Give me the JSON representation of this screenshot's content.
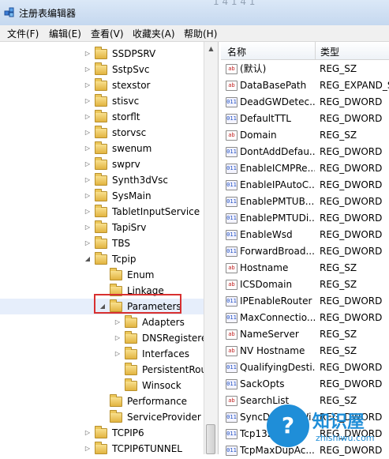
{
  "window": {
    "title": "注册表编辑器",
    "ghost_title": "1 4 1 4 1"
  },
  "menu": [
    "文件(F)",
    "编辑(E)",
    "查看(V)",
    "收藏夹(A)",
    "帮助(H)"
  ],
  "tree": [
    {
      "label": "SSDPSRV",
      "arrow": "▷"
    },
    {
      "label": "SstpSvc",
      "arrow": "▷"
    },
    {
      "label": "stexstor",
      "arrow": "▷"
    },
    {
      "label": "stisvc",
      "arrow": "▷"
    },
    {
      "label": "storflt",
      "arrow": "▷"
    },
    {
      "label": "storvsc",
      "arrow": "▷"
    },
    {
      "label": "swenum",
      "arrow": "▷"
    },
    {
      "label": "swprv",
      "arrow": "▷"
    },
    {
      "label": "Synth3dVsc",
      "arrow": "▷"
    },
    {
      "label": "SysMain",
      "arrow": "▷"
    },
    {
      "label": "TabletInputService",
      "arrow": "▷"
    },
    {
      "label": "TapiSrv",
      "arrow": "▷"
    },
    {
      "label": "TBS",
      "arrow": "▷"
    },
    {
      "label": "Tcpip",
      "arrow": "◢"
    },
    {
      "label": "Enum",
      "arrow": ""
    },
    {
      "label": "Linkage",
      "arrow": ""
    },
    {
      "label": "Parameters",
      "arrow": "◢"
    },
    {
      "label": "Adapters",
      "arrow": "▷"
    },
    {
      "label": "DNSRegistere",
      "arrow": "▷"
    },
    {
      "label": "Interfaces",
      "arrow": "▷"
    },
    {
      "label": "PersistentRou",
      "arrow": ""
    },
    {
      "label": "Winsock",
      "arrow": ""
    },
    {
      "label": "Performance",
      "arrow": ""
    },
    {
      "label": "ServiceProvider",
      "arrow": ""
    },
    {
      "label": "TCPIP6",
      "arrow": "▷"
    },
    {
      "label": "TCPIP6TUNNEL",
      "arrow": "▷"
    }
  ],
  "list": {
    "col_name": "名称",
    "col_type": "类型",
    "rows": [
      {
        "name": "(默认)",
        "type": "REG_SZ",
        "icon": "sz"
      },
      {
        "name": "DataBasePath",
        "type": "REG_EXPAND_S",
        "icon": "sz"
      },
      {
        "name": "DeadGWDetec...",
        "type": "REG_DWORD",
        "icon": "dw"
      },
      {
        "name": "DefaultTTL",
        "type": "REG_DWORD",
        "icon": "dw"
      },
      {
        "name": "Domain",
        "type": "REG_SZ",
        "icon": "sz"
      },
      {
        "name": "DontAddDefau...",
        "type": "REG_DWORD",
        "icon": "dw"
      },
      {
        "name": "EnableICMPRe...",
        "type": "REG_DWORD",
        "icon": "dw"
      },
      {
        "name": "EnableIPAutoC...",
        "type": "REG_DWORD",
        "icon": "dw"
      },
      {
        "name": "EnablePMTUB...",
        "type": "REG_DWORD",
        "icon": "dw"
      },
      {
        "name": "EnablePMTUDi...",
        "type": "REG_DWORD",
        "icon": "dw"
      },
      {
        "name": "EnableWsd",
        "type": "REG_DWORD",
        "icon": "dw"
      },
      {
        "name": "ForwardBroad...",
        "type": "REG_DWORD",
        "icon": "dw"
      },
      {
        "name": "Hostname",
        "type": "REG_SZ",
        "icon": "sz"
      },
      {
        "name": "ICSDomain",
        "type": "REG_SZ",
        "icon": "sz"
      },
      {
        "name": "IPEnableRouter",
        "type": "REG_DWORD",
        "icon": "dw"
      },
      {
        "name": "MaxConnectio...",
        "type": "REG_DWORD",
        "icon": "dw"
      },
      {
        "name": "NameServer",
        "type": "REG_SZ",
        "icon": "sz"
      },
      {
        "name": "NV Hostname",
        "type": "REG_SZ",
        "icon": "sz"
      },
      {
        "name": "QualifyingDesti...",
        "type": "REG_DWORD",
        "icon": "dw"
      },
      {
        "name": "SackOpts",
        "type": "REG_DWORD",
        "icon": "dw"
      },
      {
        "name": "SearchList",
        "type": "REG_SZ",
        "icon": "sz"
      },
      {
        "name": "SyncDomainWi...",
        "type": "REG_DWORD",
        "icon": "dw"
      },
      {
        "name": "Tcp1323Opts",
        "type": "REG_DWORD",
        "icon": "dw"
      },
      {
        "name": "TcpMaxDupAc...",
        "type": "REG_DWORD",
        "icon": "dw"
      }
    ]
  },
  "watermark": {
    "brand": "知识屋",
    "url": "zhishiwu.com",
    "badge_glyph": "?"
  }
}
